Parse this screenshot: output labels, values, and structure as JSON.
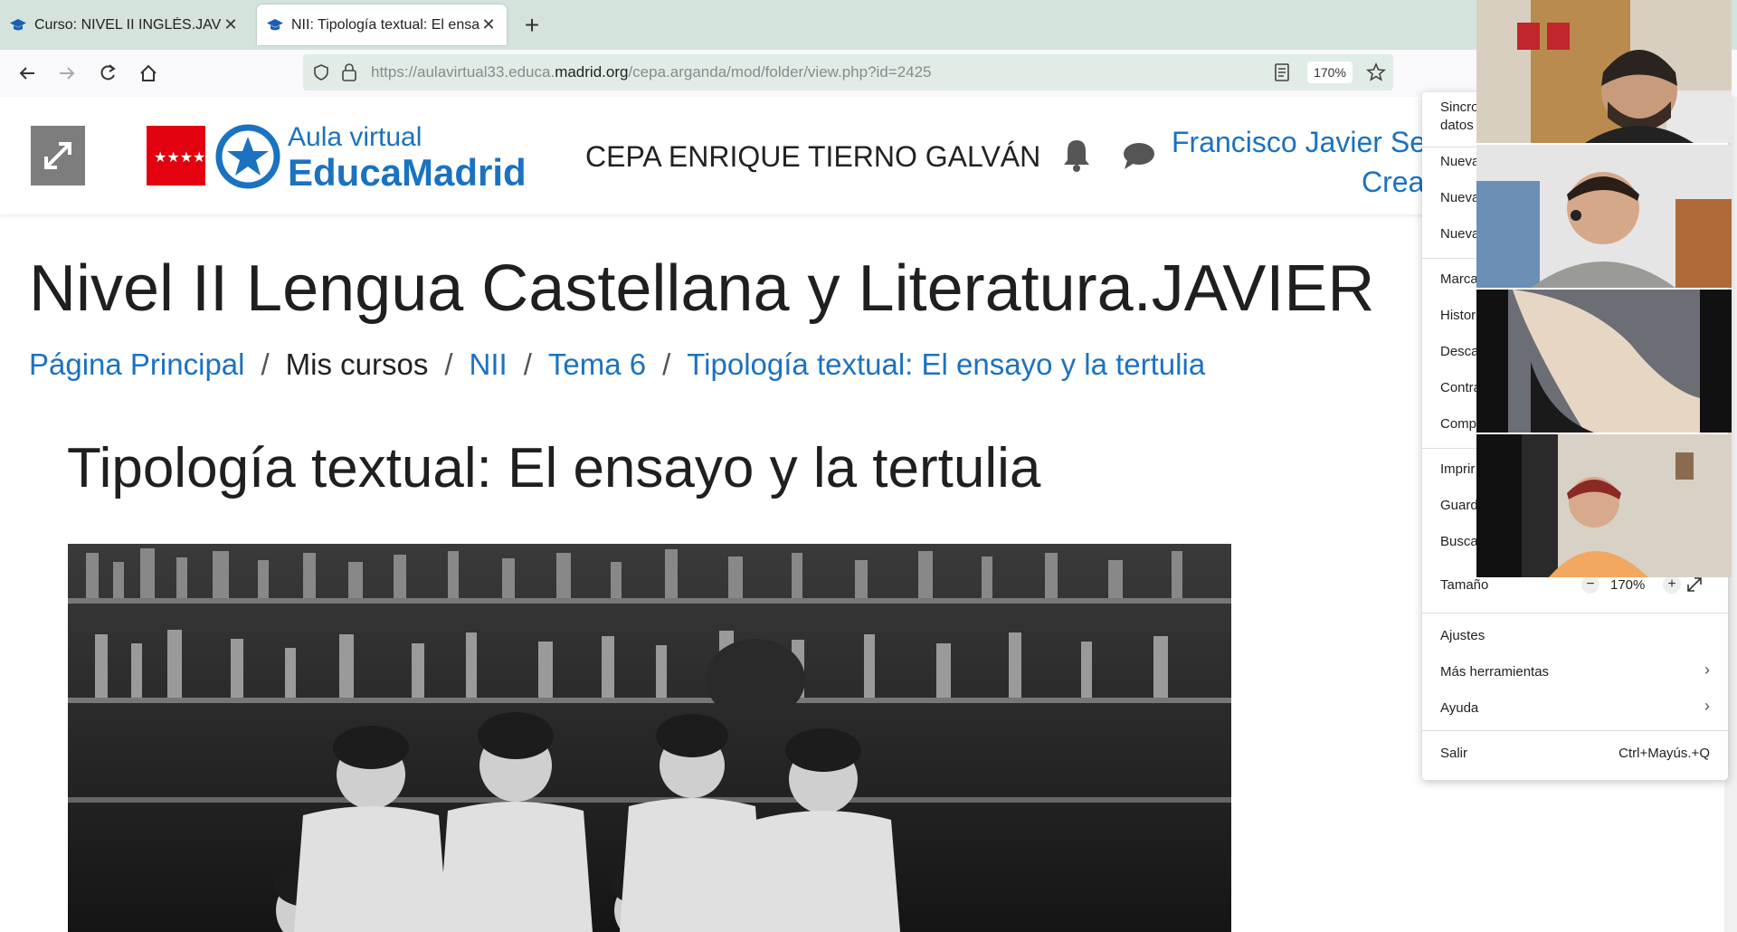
{
  "tabs": [
    {
      "title": "Curso: NIVEL II INGLÉS.JAVIER",
      "close": "✕"
    },
    {
      "title": "NII: Tipología textual: El ensayo",
      "close": "✕"
    }
  ],
  "new_tab": "+",
  "url": {
    "prefix": "https://aulavirtual33.educa.",
    "domain": "madrid.org",
    "suffix": "/cepa.arganda/mod/folder/view.php?id=2425"
  },
  "zoom_badge": "170%",
  "header": {
    "logo_line1": "Aula virtual",
    "logo_line2": "EducaMadrid",
    "school": "CEPA ENRIQUE TIERNO GALVÁN",
    "user_name": "Francisco Javier Ser",
    "user_role": "Creac"
  },
  "course_title": "Nivel II Lengua Castellana y Literatura.JAVIER",
  "breadcrumb": [
    "Página Principal",
    "Mis cursos",
    "NII",
    "Tema 6",
    "Tipología textual: El ensayo y la tertulia"
  ],
  "page_heading": "Tipología textual: El ensayo y la tertulia",
  "menu": {
    "sync": "Sincro",
    "sync2": "datos",
    "new1": "Nueva",
    "new2": "Nueva",
    "new3": "Nueva",
    "bookmarks": "Marca",
    "history": "Histor",
    "downloads": "Desca",
    "passwords": "Contra",
    "addons": "Comp",
    "print": "Imprir",
    "save": "Guard",
    "find": "Busca",
    "size_label": "Tamaño",
    "zoom_value": "170%",
    "zoom_minus": "−",
    "zoom_plus": "+",
    "settings": "Ajustes",
    "more_tools": "Más herramientas",
    "help": "Ayuda",
    "quit": "Salir",
    "quit_shortcut": "Ctrl+Mayús.+Q"
  }
}
